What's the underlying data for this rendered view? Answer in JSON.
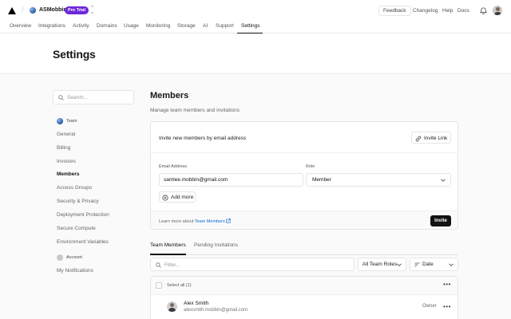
{
  "topbar": {
    "team_name": "ASMobbin",
    "plan_badge": "Pro Trial",
    "feedback": "Feedback",
    "links": [
      "Changelog",
      "Help",
      "Docs"
    ]
  },
  "nav": {
    "items": [
      "Overview",
      "Integrations",
      "Activity",
      "Domains",
      "Usage",
      "Monitoring",
      "Storage",
      "AI",
      "Support",
      "Settings"
    ],
    "active": "Settings"
  },
  "page": {
    "title": "Settings"
  },
  "sidebar": {
    "search_placeholder": "Search...",
    "team_section": "Team",
    "team_items": [
      "General",
      "Billing",
      "Invoices",
      "Members",
      "Access Groups",
      "Security & Privacy",
      "Deployment Protection",
      "Secure Compute",
      "Environment Variables"
    ],
    "active_item": "Members",
    "account_section": "Account",
    "account_items": [
      "My Notifications"
    ]
  },
  "members": {
    "title": "Members",
    "subtitle": "Manage team members and invitations",
    "invite": {
      "title": "Invite new members by email address",
      "invite_link_label": "Invite Link",
      "email_label": "Email Address",
      "email_value": "samlee.mobbin@gmail.com",
      "role_label": "Role",
      "role_value": "Member",
      "add_more_label": "Add more",
      "learn_more_prefix": "Learn more about",
      "learn_more_link": "Team Members",
      "invite_button": "Invite"
    },
    "tabs": [
      "Team Members",
      "Pending Invitations"
    ],
    "active_tab": "Team Members",
    "filter_placeholder": "Filter...",
    "roles_filter": "All Team Roles",
    "sort": "Date",
    "select_all": "Select all (1)",
    "list": [
      {
        "name": "Alex Smith",
        "email": "alexsmith.mobbin@gmail.com",
        "role": "Owner"
      }
    ]
  },
  "colors": {
    "accent": "#6d28d9",
    "link": "#0a66d8",
    "primary_button": "#111111"
  }
}
